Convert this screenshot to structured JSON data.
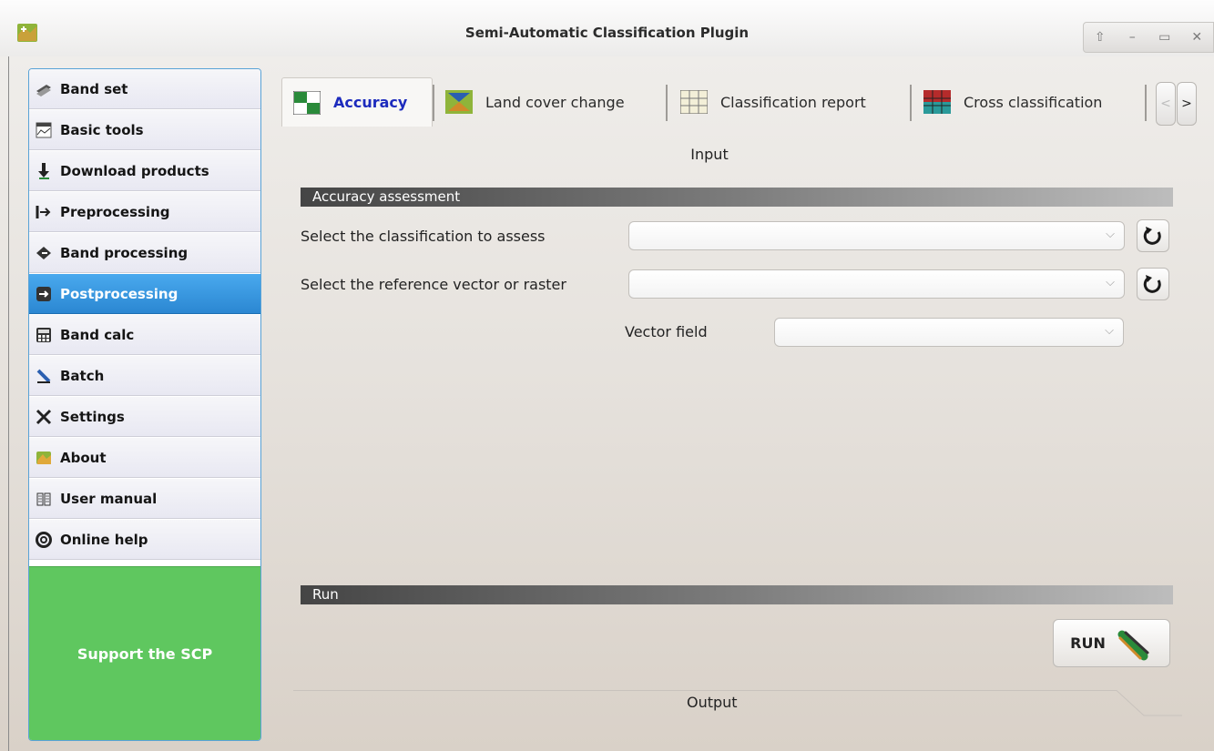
{
  "window": {
    "title": "Semi-Automatic Classification Plugin",
    "controls": [
      "⇧",
      "–",
      "▭",
      "✕"
    ]
  },
  "sidebar": {
    "items": [
      {
        "label": "Band set",
        "icon": "band-set-icon"
      },
      {
        "label": "Basic tools",
        "icon": "basic-tools-icon"
      },
      {
        "label": "Download products",
        "icon": "download-icon"
      },
      {
        "label": "Preprocessing",
        "icon": "preprocessing-icon"
      },
      {
        "label": "Band processing",
        "icon": "band-processing-icon"
      },
      {
        "label": "Postprocessing",
        "icon": "postprocessing-icon",
        "active": true
      },
      {
        "label": "Band calc",
        "icon": "calculator-icon"
      },
      {
        "label": "Batch",
        "icon": "batch-icon"
      },
      {
        "label": "Settings",
        "icon": "settings-icon"
      },
      {
        "label": "About",
        "icon": "about-icon"
      },
      {
        "label": "User manual",
        "icon": "user-manual-icon"
      },
      {
        "label": "Online help",
        "icon": "lifebuoy-icon"
      }
    ],
    "support": "Support the SCP"
  },
  "tabs": [
    {
      "label": "Accuracy",
      "active": true
    },
    {
      "label": "Land cover change"
    },
    {
      "label": "Classification report"
    },
    {
      "label": "Cross classification"
    }
  ],
  "tab_scroll": {
    "left": "<",
    "right": ">"
  },
  "main": {
    "input_label": "Input",
    "accuracy_group": "Accuracy assessment",
    "classification_label": "Select the classification to assess",
    "classification_value": "",
    "reference_label": "Select the reference vector or raster",
    "reference_value": "",
    "vector_field_label": "Vector field",
    "vector_field_value": "",
    "run_group": "Run",
    "run_button": "RUN",
    "output_label": "Output"
  },
  "colors": {
    "active_nav": "#2b87d2",
    "active_tab_text": "#1d2bbd",
    "support_bg": "#5fc75f"
  }
}
